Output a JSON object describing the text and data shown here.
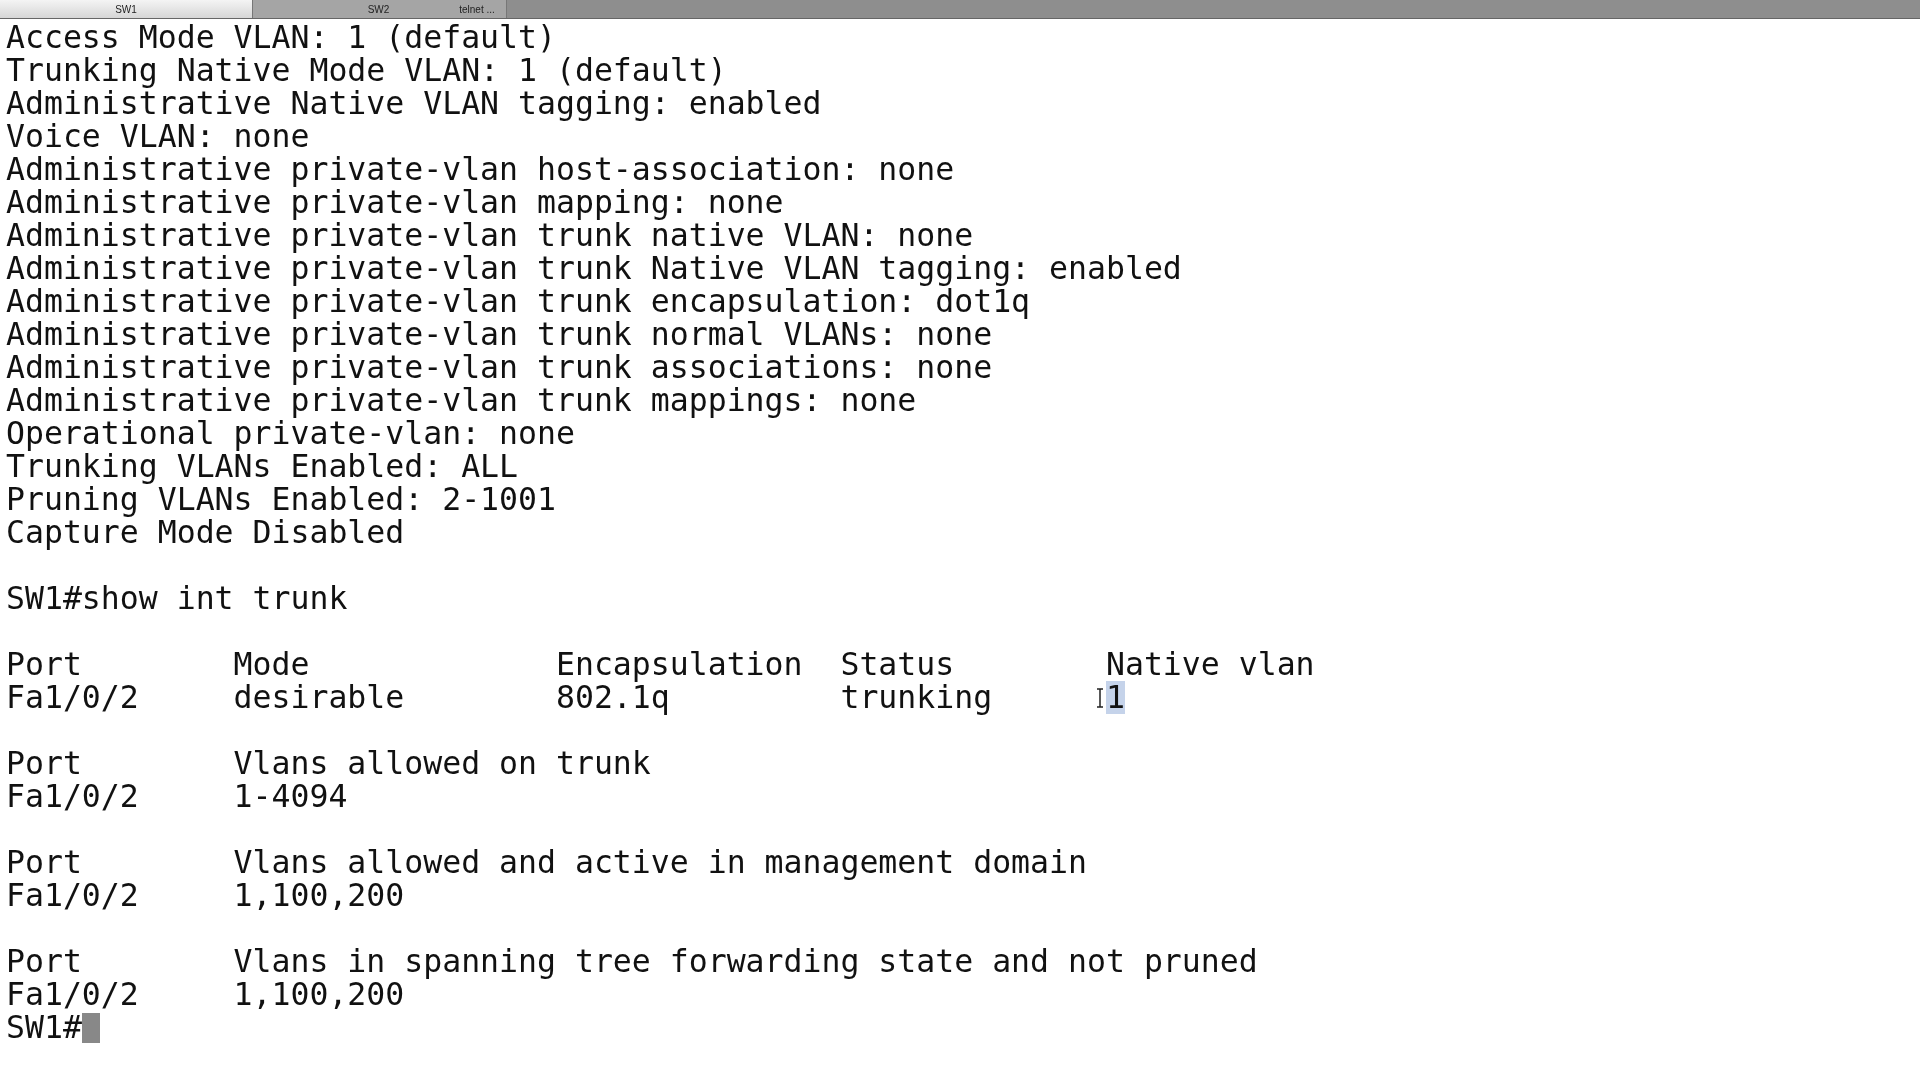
{
  "tabs": [
    {
      "label": "SW1",
      "selected": true
    },
    {
      "label": "SW2",
      "selected": false
    },
    {
      "label": "telnet ...",
      "selected": false
    }
  ],
  "terminal": {
    "blocks": [
      {
        "lines": [
          {
            "text": "Access Mode VLAN: 1 (default)"
          },
          {
            "text": "Trunking Native Mode VLAN: 1 (default)"
          },
          {
            "text": "Administrative Native VLAN tagging: enabled"
          },
          {
            "text": "Voice VLAN: none"
          },
          {
            "text": "Administrative private-vlan host-association: none"
          },
          {
            "text": "Administrative private-vlan mapping: none"
          },
          {
            "text": "Administrative private-vlan trunk native VLAN: none"
          },
          {
            "text": "Administrative private-vlan trunk Native VLAN tagging: enabled"
          },
          {
            "text": "Administrative private-vlan trunk encapsulation: dot1q"
          },
          {
            "text": "Administrative private-vlan trunk normal VLANs: none"
          },
          {
            "text": "Administrative private-vlan trunk associations: none"
          },
          {
            "text": "Administrative private-vlan trunk mappings: none"
          },
          {
            "text": "Operational private-vlan: none"
          },
          {
            "text": "Trunking VLANs Enabled: ALL"
          },
          {
            "text": "Pruning VLANs Enabled: 2-1001"
          },
          {
            "text": "Capture Mode Disabled"
          }
        ]
      },
      {
        "lines": [
          {
            "text": "SW1#show int trunk"
          }
        ]
      },
      {
        "lines": [
          {
            "text": "Port        Mode             Encapsulation  Status        Native vlan"
          },
          {
            "text": "Fa1/0/2     desirable        802.1q         trunking",
            "selection": "1"
          }
        ]
      },
      {
        "lines": [
          {
            "text": "Port        Vlans allowed on trunk"
          },
          {
            "text": "Fa1/0/2     1-4094"
          }
        ]
      },
      {
        "lines": [
          {
            "text": "Port        Vlans allowed and active in management domain"
          },
          {
            "text": "Fa1/0/2     1,100,200"
          }
        ]
      },
      {
        "lines": [
          {
            "text": "Port        Vlans in spanning tree forwarding state and not pruned"
          },
          {
            "text": "Fa1/0/2     1,100,200"
          },
          {
            "text": "SW1#",
            "cursor": true
          }
        ]
      }
    ]
  }
}
